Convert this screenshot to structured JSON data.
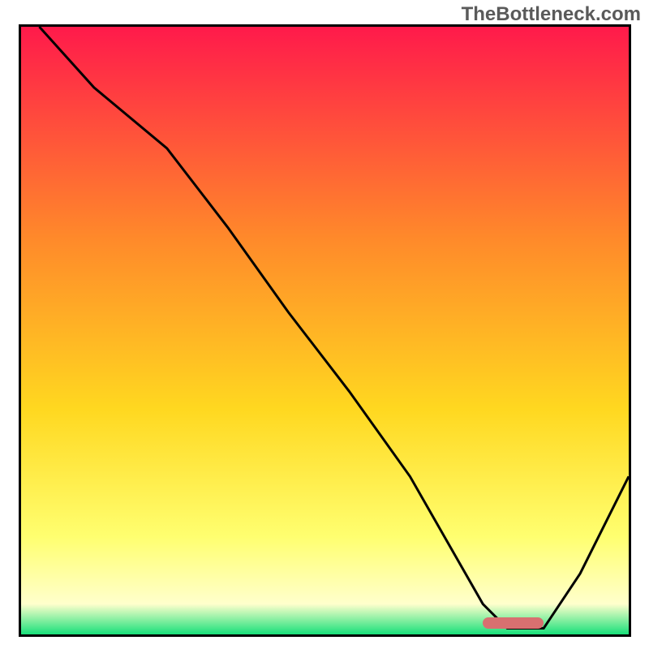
{
  "watermark": "TheBottleneck.com",
  "colors": {
    "top": "#ff1a4b",
    "mid1": "#ff8a2a",
    "mid2": "#ffd820",
    "low": "#ffff70",
    "pale": "#ffffcc",
    "bottom": "#18e07a",
    "curve": "#000000",
    "marker": "#d87070",
    "border": "#000000"
  },
  "chart_data": {
    "type": "line",
    "title": "",
    "xlabel": "",
    "ylabel": "",
    "xlim": [
      0,
      100
    ],
    "ylim": [
      0,
      100
    ],
    "series": [
      {
        "name": "bottleneck-curve",
        "x": [
          3,
          12,
          24,
          34,
          44,
          54,
          64,
          72,
          76,
          80,
          86,
          92,
          100
        ],
        "y": [
          100,
          90,
          80,
          67,
          53,
          40,
          26,
          12,
          5,
          1,
          1,
          10,
          26
        ]
      }
    ],
    "optimal_marker": {
      "x_start": 76,
      "x_end": 86,
      "y": 1
    },
    "annotations": []
  }
}
